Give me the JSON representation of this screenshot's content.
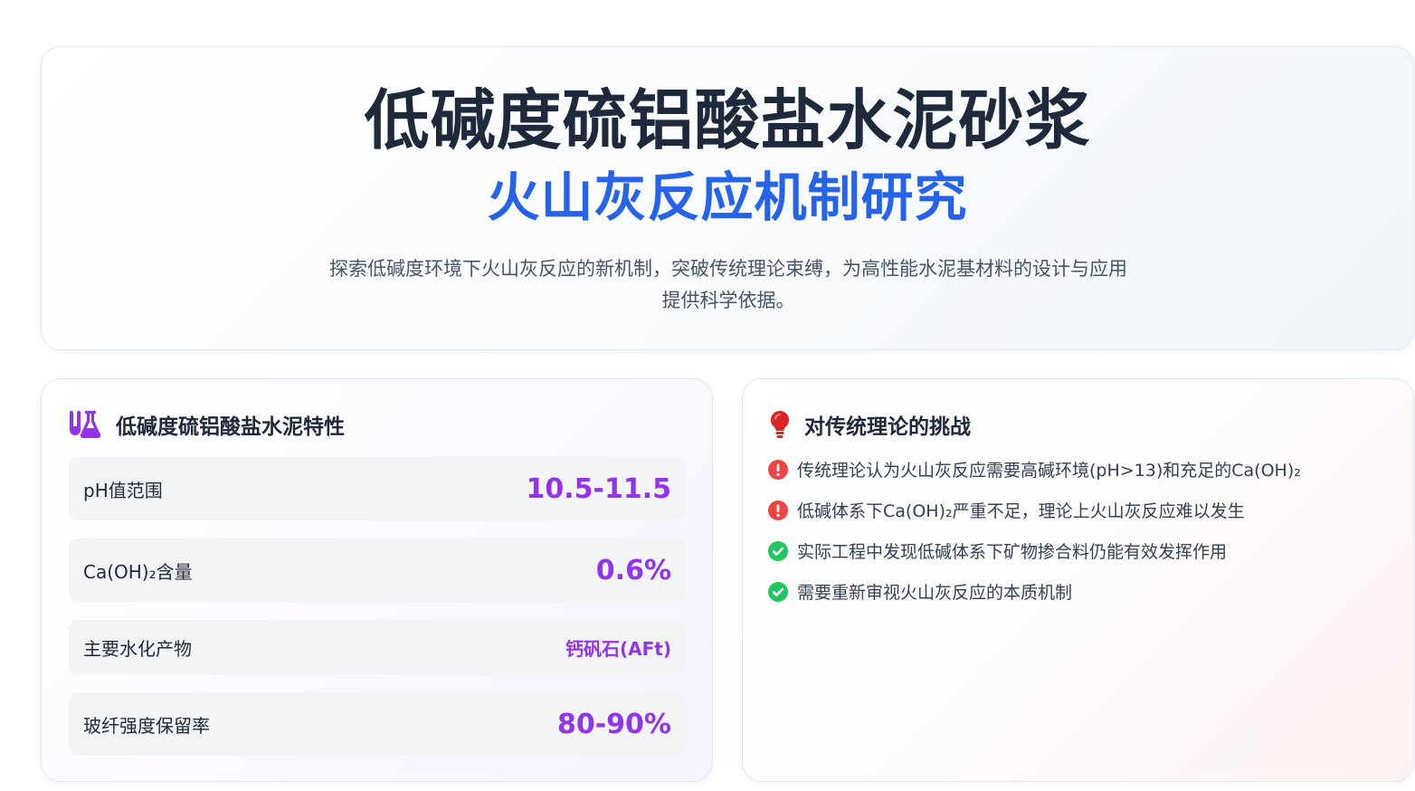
{
  "hero": {
    "title": "低碱度硫铝酸盐水泥砂浆",
    "subtitle": "火山灰反应机制研究",
    "description_line1": "探索低碱度环境下火山灰反应的新机制，突破传统理论束缚，为高性能水泥基材料的设计与应用",
    "description_line2": "提供科学依据。"
  },
  "properties_card": {
    "icon": "flask-icon",
    "title": "低碱度硫铝酸盐水泥特性",
    "rows": [
      {
        "label": "pH值范围",
        "value": "10.5-11.5"
      },
      {
        "label": "Ca(OH)₂含量",
        "value": "0.6%"
      },
      {
        "label": "主要水化产物",
        "value": "钙矾石(AFt)"
      },
      {
        "label": "玻纤强度保留率",
        "value": "80-90%"
      }
    ]
  },
  "challenge_card": {
    "icon": "lightbulb-icon",
    "title": "对传统理论的挑战",
    "items": [
      {
        "status": "warning",
        "text": "传统理论认为火山灰反应需要高碱环境(pH>13)和充足的Ca(OH)₂"
      },
      {
        "status": "warning",
        "text": "低碱体系下Ca(OH)₂严重不足，理论上火山灰反应难以发生"
      },
      {
        "status": "ok",
        "text": "实际工程中发现低碱体系下矿物掺合料仍能有效发挥作用"
      },
      {
        "status": "ok",
        "text": "需要重新审视火山灰反应的本质机制"
      }
    ]
  },
  "colors": {
    "accent_blue": "#2563eb",
    "accent_purple": "#9333ea",
    "warning_red": "#ef4444",
    "ok_green": "#22c55e",
    "bulb_red": "#dc2626"
  }
}
